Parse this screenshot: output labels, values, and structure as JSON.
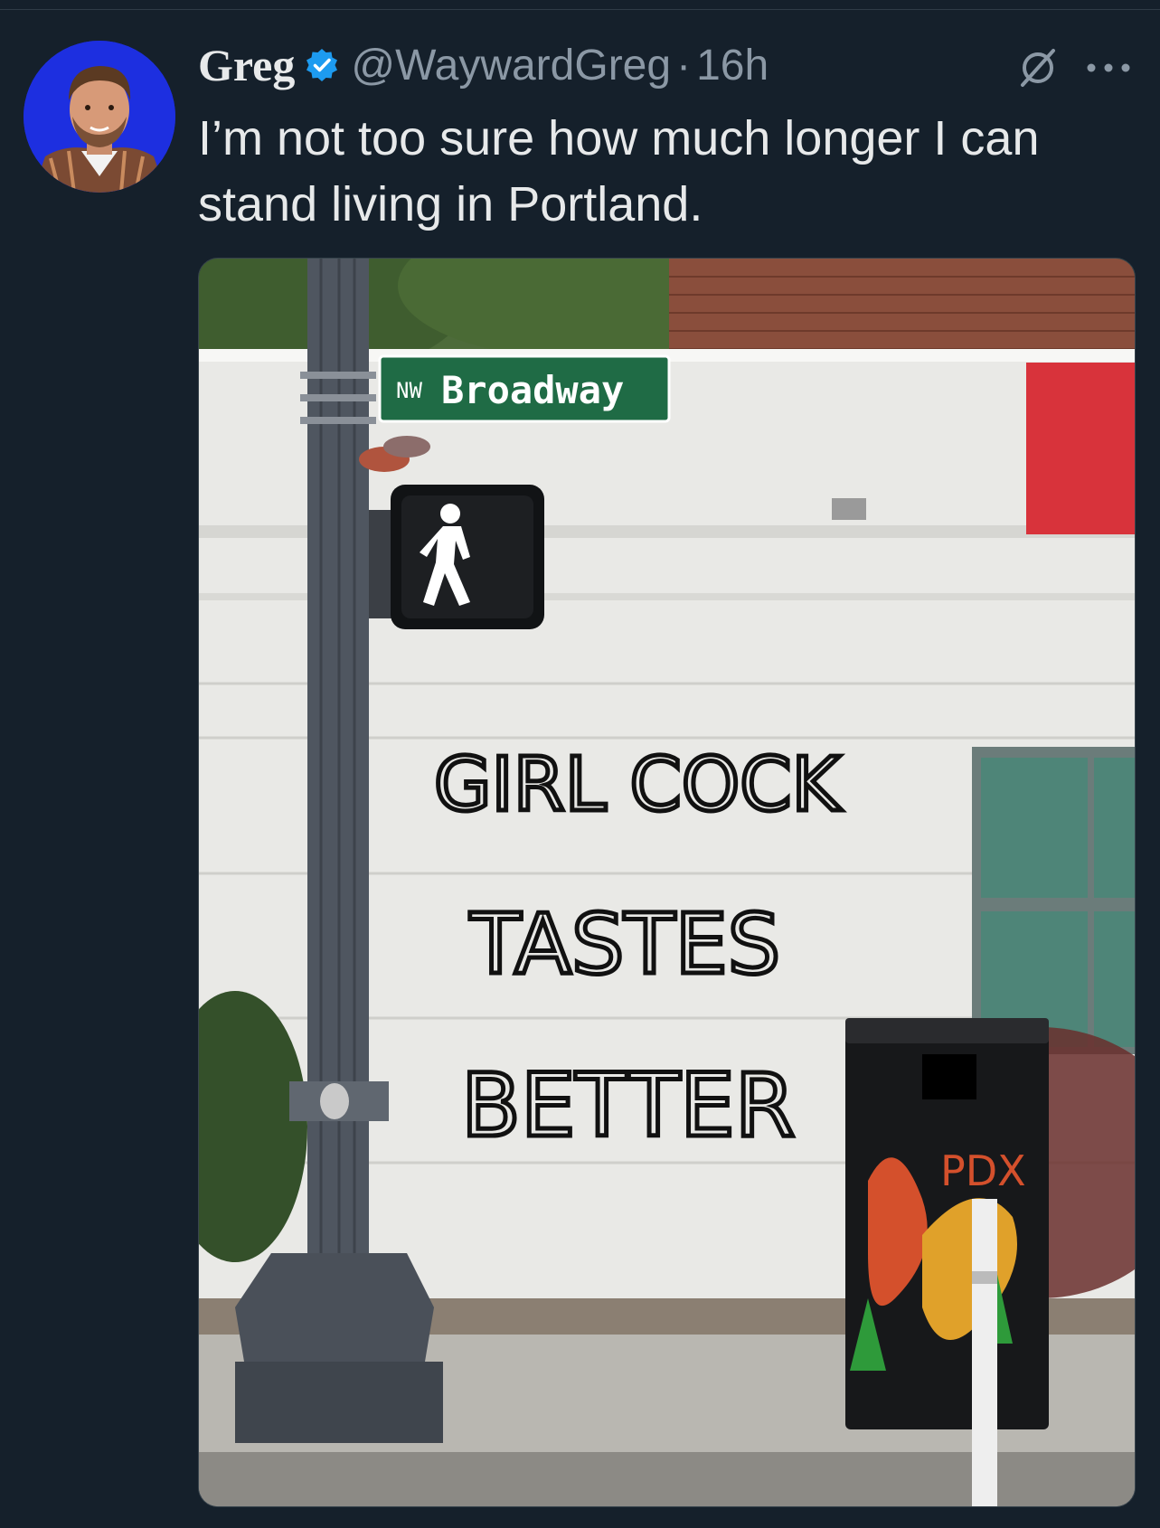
{
  "tweet": {
    "author_name": "Greg",
    "handle": "@WaywardGreg",
    "separator": "·",
    "time": "16h",
    "text": "I’m not too sure how much longer I can stand living in Portland."
  },
  "photo": {
    "street_sign": {
      "prefix": "NW",
      "name": "Broadway"
    },
    "graffiti_lines": [
      "GIRL COCK",
      "TASTES",
      "BETTER"
    ],
    "bin_text": "PDX"
  },
  "colors": {
    "background": "#15202b",
    "verified_badge": "#1d9bf0",
    "avatar_bg": "#1d2fe0",
    "secondary_text": "#8b98a5"
  },
  "icons": [
    "verified-badge-icon",
    "grok-icon",
    "more-options-icon"
  ]
}
